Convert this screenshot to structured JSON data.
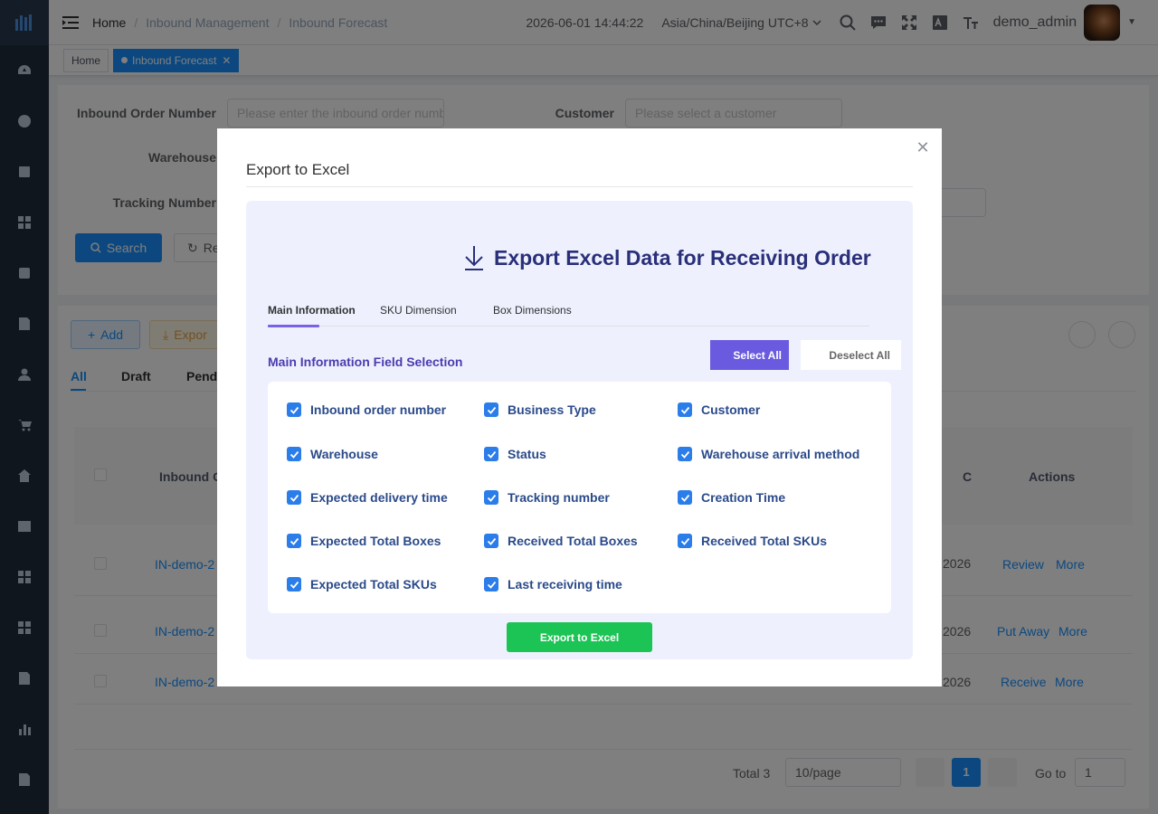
{
  "header": {
    "breadcrumb": [
      "Home",
      "Inbound Management",
      "Inbound Forecast"
    ],
    "datetime": "2026-06-01 14:44:22",
    "timezone": "Asia/China/Beijing UTC+8",
    "username": "demo_admin"
  },
  "tags": {
    "home": "Home",
    "active": "Inbound Forecast"
  },
  "filters": {
    "order_label": "Inbound Order Number",
    "order_placeholder": "Please enter the inbound order number",
    "customer_label": "Customer",
    "customer_placeholder": "Please select a customer",
    "warehouse_label": "Warehouse",
    "tracking_label": "Tracking Number",
    "search_btn": "Search",
    "reset_btn": "Re"
  },
  "list": {
    "add_btn": "Add",
    "export_btn": "Expor",
    "tabs": [
      "All",
      "Draft",
      "Pend"
    ],
    "col_order": "Inbound O",
    "col_actions": "Actions",
    "col_c": "C",
    "rows": [
      {
        "order": "IN-demo-2",
        "date": "2026",
        "action1": "Review",
        "more": "More"
      },
      {
        "order": "IN-demo-2",
        "date": "2026",
        "action1": "Put Away",
        "more": "More"
      },
      {
        "order": "IN-demo-2",
        "date": "2026",
        "action1": "Receive",
        "more": "More"
      }
    ],
    "pager_total": "Total 3",
    "page_size": "10/page",
    "current_page": "1",
    "goto_label": "Go to",
    "goto_value": "1"
  },
  "modal": {
    "title": "Export to Excel",
    "heading": "Export Excel Data for Receiving Order",
    "tabs": [
      "Main Information",
      "SKU Dimension",
      "Box Dimensions"
    ],
    "section_title": "Main Information Field Selection",
    "select_all": "Select All",
    "deselect_all": "Deselect All",
    "fields": [
      "Inbound order number",
      "Business Type",
      "Customer",
      "Warehouse",
      "Status",
      "Warehouse arrival method",
      "Expected delivery time",
      "Tracking number",
      "Creation Time",
      "Expected Total Boxes",
      "Received Total Boxes",
      "Received Total SKUs",
      "Expected Total SKUs",
      "Last receiving time"
    ],
    "export_btn": "Export to Excel"
  },
  "colors": {
    "primary": "#1890ff",
    "sidebar": "#1f2d3d",
    "accent_purple": "#6a5ae0",
    "export_green": "#1bc454",
    "checkbox": "#2b7de9"
  }
}
